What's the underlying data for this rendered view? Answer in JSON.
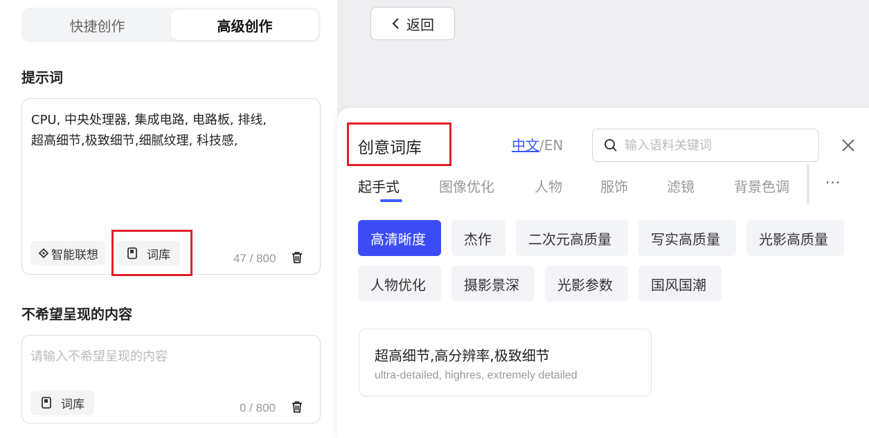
{
  "left_panel": {
    "mode_tabs": [
      {
        "label": "快捷创作"
      },
      {
        "label": "高级创作"
      }
    ],
    "prompt": {
      "title": "提示词",
      "text": "CPU, 中央处理器, 集成电路, 电路板, 排线, 超高细节,极致细节,细腻纹理, 科技感,",
      "smart_button": "智能联想",
      "library_button": "词库",
      "counter": "47 / 800"
    },
    "negative": {
      "title": "不希望呈现的内容",
      "placeholder": "请输入不希望呈现的内容",
      "library_button": "词库",
      "counter": "0 / 800"
    }
  },
  "back_button": "返回",
  "dictionary": {
    "title": "创意词库",
    "lang_zh": "中文",
    "lang_sep": "/",
    "lang_en": "EN",
    "search_placeholder": "输入语料关键词",
    "categories": [
      "起手式",
      "图像优化",
      "人物",
      "服饰",
      "滤镜",
      "背景色调"
    ],
    "more": "···",
    "tags": [
      "高清晰度",
      "杰作",
      "二次元高质量",
      "写实高质量",
      "光影高质量",
      "人物优化",
      "摄影景深",
      "光影参数",
      "国风国潮"
    ],
    "card": {
      "zh": "超高细节,高分辨率,极致细节",
      "en": "ultra-detailed, highres, extremely detailed"
    }
  },
  "colors": {
    "accent": "#3b4cf6",
    "highlight_box": "#e0202a"
  }
}
